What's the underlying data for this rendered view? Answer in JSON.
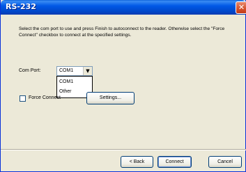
{
  "window": {
    "title": "RS-232",
    "close_glyph": "✕",
    "close_icon": "close-icon"
  },
  "main": {
    "description": "Select the com port to use and press Finish to autoconnect to the reader. Otherwise select the \"Force Connect\" checkbox to connect at the specified settings.",
    "com_port_label": "Com Port:",
    "com_port_value": "COM1",
    "dropdown_arrow_glyph": "▼",
    "com_port_options": [
      "COM1",
      "Other"
    ],
    "force_connect_label": "Force Connect",
    "force_connect_checked": false,
    "settings_label": "Settings..."
  },
  "footer": {
    "back_label": "< Back",
    "connect_label": "Connect",
    "cancel_label": "Cancel"
  },
  "colors": {
    "titlebar": "#0058e6",
    "dialog_bg": "#ece9d8",
    "close_button": "#d4522c"
  }
}
